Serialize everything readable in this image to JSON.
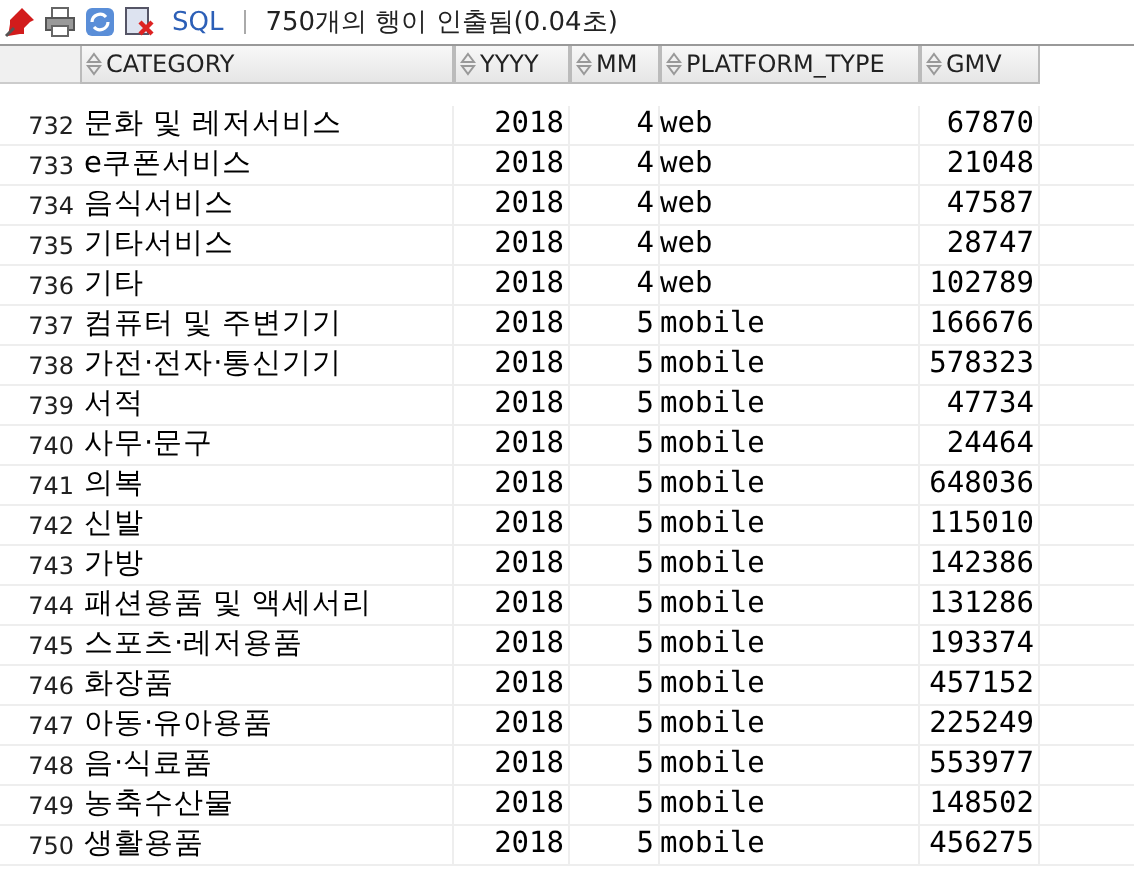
{
  "toolbar": {
    "sql_label": "SQL",
    "status": "750개의 행이 인출됨(0.04초)"
  },
  "table": {
    "columns": [
      "CATEGORY",
      "YYYY",
      "MM",
      "PLATFORM_TYPE",
      "GMV"
    ],
    "rows": [
      {
        "num": "732",
        "cells": [
          "문화 및 레저서비스",
          "2018",
          "4",
          "web",
          "67870"
        ]
      },
      {
        "num": "733",
        "cells": [
          "e쿠폰서비스",
          "2018",
          "4",
          "web",
          "21048"
        ]
      },
      {
        "num": "734",
        "cells": [
          "음식서비스",
          "2018",
          "4",
          "web",
          "47587"
        ]
      },
      {
        "num": "735",
        "cells": [
          "기타서비스",
          "2018",
          "4",
          "web",
          "28747"
        ]
      },
      {
        "num": "736",
        "cells": [
          "기타",
          "2018",
          "4",
          "web",
          "102789"
        ]
      },
      {
        "num": "737",
        "cells": [
          "컴퓨터 및 주변기기",
          "2018",
          "5",
          "mobile",
          "166676"
        ]
      },
      {
        "num": "738",
        "cells": [
          "가전·전자·통신기기",
          "2018",
          "5",
          "mobile",
          "578323"
        ]
      },
      {
        "num": "739",
        "cells": [
          "서적",
          "2018",
          "5",
          "mobile",
          "47734"
        ]
      },
      {
        "num": "740",
        "cells": [
          "사무·문구",
          "2018",
          "5",
          "mobile",
          "24464"
        ]
      },
      {
        "num": "741",
        "cells": [
          "의복",
          "2018",
          "5",
          "mobile",
          "648036"
        ]
      },
      {
        "num": "742",
        "cells": [
          "신발",
          "2018",
          "5",
          "mobile",
          "115010"
        ]
      },
      {
        "num": "743",
        "cells": [
          "가방",
          "2018",
          "5",
          "mobile",
          "142386"
        ]
      },
      {
        "num": "744",
        "cells": [
          "패션용품 및 액세서리",
          "2018",
          "5",
          "mobile",
          "131286"
        ]
      },
      {
        "num": "745",
        "cells": [
          "스포츠·레저용품",
          "2018",
          "5",
          "mobile",
          "193374"
        ]
      },
      {
        "num": "746",
        "cells": [
          "화장품",
          "2018",
          "5",
          "mobile",
          "457152"
        ]
      },
      {
        "num": "747",
        "cells": [
          "아동·유아용품",
          "2018",
          "5",
          "mobile",
          "225249"
        ]
      },
      {
        "num": "748",
        "cells": [
          "음·식료품",
          "2018",
          "5",
          "mobile",
          "553977"
        ]
      },
      {
        "num": "749",
        "cells": [
          "농축수산물",
          "2018",
          "5",
          "mobile",
          "148502"
        ]
      },
      {
        "num": "750",
        "cells": [
          "생활용품",
          "2018",
          "5",
          "mobile",
          "456275"
        ]
      }
    ]
  }
}
